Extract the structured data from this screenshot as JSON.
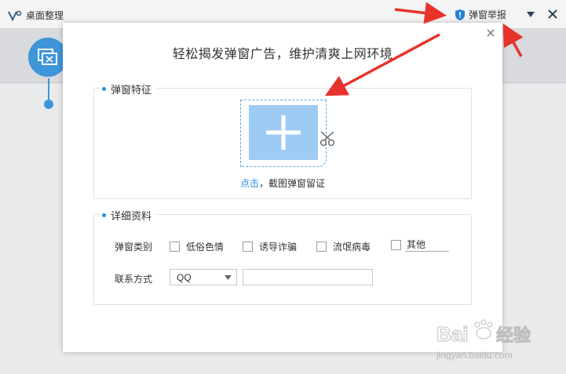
{
  "app": {
    "title": "桌面整理"
  },
  "toolbar": {
    "report_label": "弹窗举报"
  },
  "dialog": {
    "headline": "轻松揭发弹窗广告，维护清爽上网环境",
    "section_features": {
      "legend": "弹窗特征",
      "capture_link": "点击",
      "capture_text": "，截图弹窗留证"
    },
    "section_details": {
      "legend": "详细资料",
      "category_label": "弹窗类别",
      "categories": [
        "低俗色情",
        "诱导诈骗",
        "流氓病毒"
      ],
      "other_value": "其他",
      "contact_label": "联系方式",
      "contact_selected": "QQ",
      "contact_value": ""
    }
  },
  "watermark": {
    "line1": "Bai",
    "line2": "经验",
    "url": "jingyan.baidu.com"
  },
  "colors": {
    "accent": "#2a8ee0",
    "capture_fill": "#9ecbf4",
    "arrow": "#e8322c"
  },
  "icons": {
    "app": "app-logo-icon",
    "report": "shield-icon",
    "menu": "triangle-down-icon",
    "close": "close-icon",
    "add": "plus-icon",
    "cut": "scissors-icon"
  }
}
